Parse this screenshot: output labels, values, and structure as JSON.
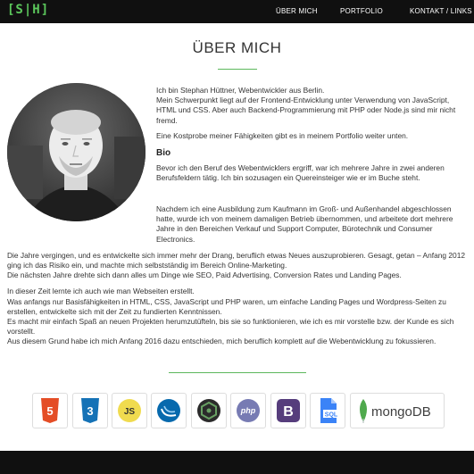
{
  "brand": {
    "logo": "[S|H]"
  },
  "nav": {
    "items": [
      "ÜBER MICH",
      "PORTFOLIO",
      "KONTAKT / LINKS"
    ]
  },
  "about": {
    "title": "ÜBER MICH",
    "intro": [
      "Ich bin Stephan Hüttner, Webentwickler aus Berlin.",
      "Mein Schwerpunkt liegt auf der Frontend-Entwicklung unter Verwendung von JavaScript, HTML und CSS. Aber auch Backend-Programmierung mit PHP oder Node.js sind mir nicht fremd.",
      "Eine Kostprobe meiner Fähigkeiten gibt es in meinem Portfolio weiter unten."
    ],
    "bio_heading": "Bio",
    "bio": [
      "Bevor ich den Beruf des Webentwicklers ergriff, war ich mehrere Jahre in zwei anderen Berufsfeldern tätig. Ich bin sozusagen ein Quereinsteiger wie er im Buche steht.",
      "Nachdem ich eine Ausbildung zum Kaufmann im Groß- und Außenhandel abgeschlossen hatte, wurde ich von meinem damaligen Betrieb übernommen, und arbeitete dort mehrere Jahre in den Bereichen Verkauf und Support Computer, Bürotechnik und Consumer Electronics.",
      "Die Jahre vergingen, und es entwickelte sich immer mehr der Drang, beruflich etwas Neues auszuprobieren. Gesagt, getan – Anfang 2012 ging ich das Risiko ein, und machte mich selbstständig im Bereich Online-Marketing.",
      "Die nächsten Jahre drehte sich dann alles um Dinge wie SEO, Paid Advertising, Conversion Rates und Landing Pages.",
      "In dieser Zeit lernte ich auch wie man Webseiten erstellt.",
      "Was anfangs nur Basisfähigkeiten in HTML, CSS, JavaScript und PHP waren, um einfache Landing Pages und Wordpress-Seiten zu erstellen, entwickelte sich mit der Zeit zu fundierten Kenntnissen.",
      "Es macht mir einfach Spaß an neuen Projekten herumzutüfteln, bis sie so funktionieren, wie ich es mir vorstelle bzw. der Kunde es sich vorstellt.",
      "Aus diesem Grund habe ich mich Anfang 2016 dazu entschieden, mich beruflich komplett auf die Webentwicklung zu fokussieren."
    ]
  },
  "tech": [
    {
      "icon": "html5-icon",
      "label": "5",
      "color": "#e44d26"
    },
    {
      "icon": "css3-icon",
      "label": "3",
      "color": "#1572b6"
    },
    {
      "icon": "js-icon",
      "label": "JS",
      "color": "#f0db4f"
    },
    {
      "icon": "jquery-icon",
      "label": "",
      "color": "#0769ad"
    },
    {
      "icon": "nodejs-icon",
      "label": "",
      "color": "#3c873a"
    },
    {
      "icon": "php-icon",
      "label": "php",
      "color": "#777bb3"
    },
    {
      "icon": "bootstrap-icon",
      "label": "B",
      "color": "#563d7c"
    },
    {
      "icon": "sql-icon",
      "label": "SQL",
      "color": "#3b83f7"
    },
    {
      "icon": "mongodb-icon",
      "label": "mongoDB",
      "color": "#4fa94d"
    }
  ]
}
